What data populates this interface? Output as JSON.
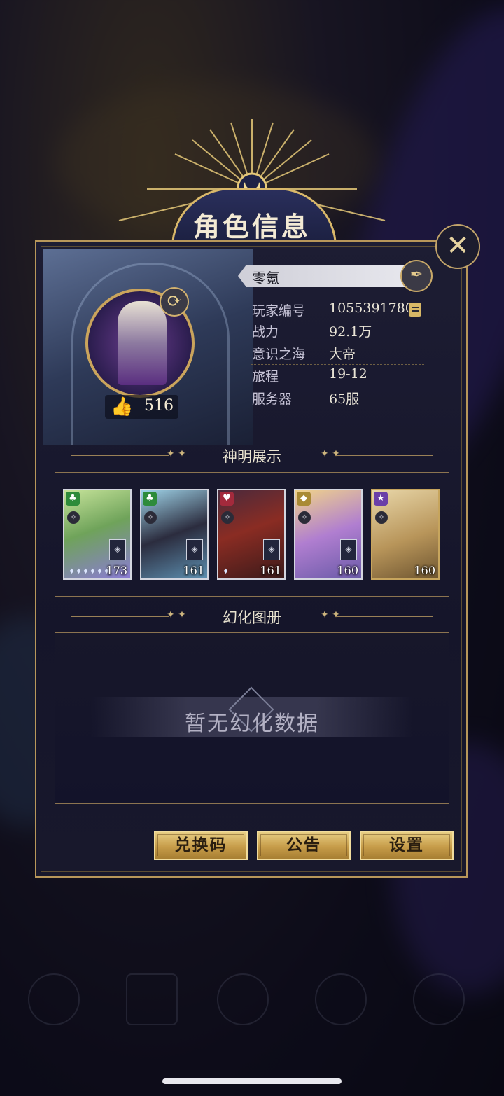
{
  "dialog": {
    "title": "角色信息"
  },
  "profile": {
    "name": "零氪",
    "likes": "516",
    "info": [
      {
        "label": "玩家编号",
        "value": "10553917800"
      },
      {
        "label": "战力",
        "value": "92.1万"
      },
      {
        "label": "意识之海",
        "value": "大帝"
      },
      {
        "label": "旅程",
        "value": "19-12"
      },
      {
        "label": "服务器",
        "value": "65服"
      }
    ]
  },
  "sections": {
    "gods_title": "神明展示",
    "album_title": "幻化图册",
    "album_empty": "暂无幻化数据"
  },
  "cards": [
    {
      "level": "173",
      "badge_color": "#2e8b3a",
      "art_color": "#8fbf6a",
      "stars": "♦♦♦♦♦♦"
    },
    {
      "level": "161",
      "badge_color": "#2e8b3a",
      "art_color": "#3c3d57",
      "stars": ""
    },
    {
      "level": "161",
      "badge_color": "#a32a3c",
      "art_color": "#7a2a25",
      "stars": "♦"
    },
    {
      "level": "160",
      "badge_color": "#a98a35",
      "art_color": "#b79a6a",
      "stars": ""
    },
    {
      "level": "160",
      "badge_color": "#6a3fa8",
      "art_color": "#c9ac72",
      "stars": ""
    }
  ],
  "buttons": {
    "redeem": "兑换码",
    "notice": "公告",
    "settings": "设置"
  },
  "colors": {
    "gold_accent": "#d9b86a",
    "panel_bg": "#1d1d33"
  }
}
